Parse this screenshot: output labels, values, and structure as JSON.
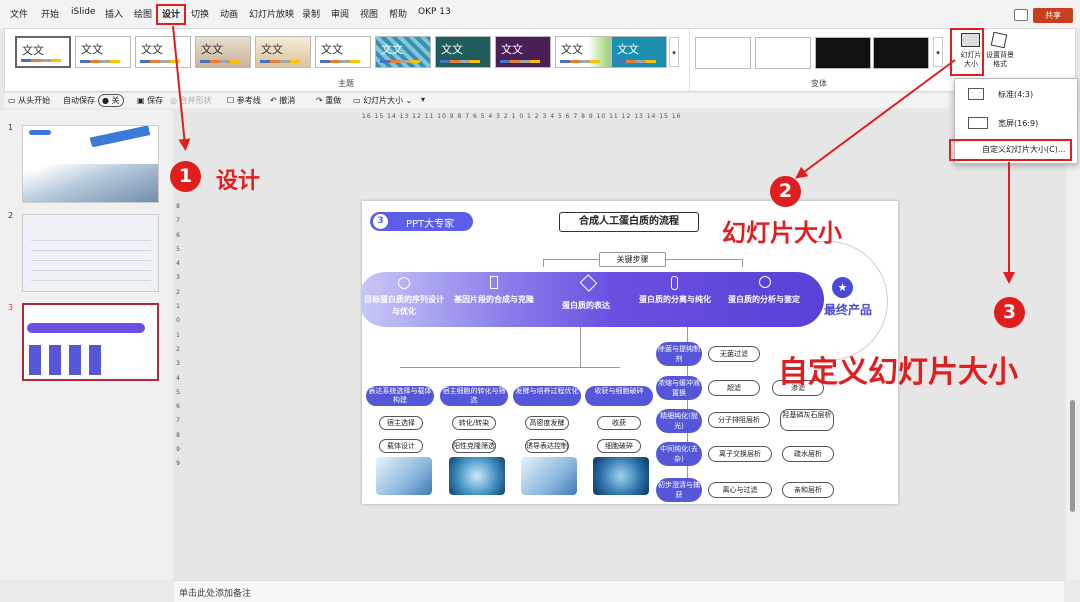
{
  "menu": [
    "文件",
    "开始",
    "iSlide",
    "插入",
    "绘图",
    "设计",
    "切换",
    "动画",
    "幻灯片放映",
    "录制",
    "审阅",
    "视图",
    "帮助",
    "OKP 13"
  ],
  "share_label": "共享",
  "ribbon": {
    "theme_text": "文文",
    "themes_label": "主题",
    "variants_label": "变体",
    "slide_size_label": "幻灯片大小",
    "bg_format_label": "设置背景格式"
  },
  "qat": [
    "从头开始",
    "自动保存",
    "关",
    "保存",
    "合并形状",
    "参考线",
    "撤消",
    "重做",
    "幻灯片大小"
  ],
  "rulers": {
    "horizontal": "16 15 14 13 12 11 10 9 8 7 6 5 4 3 2 1 0 1 2 3 4 5 6 7 8 9 10 11 12 13 14 15 16",
    "vertical": [
      "8",
      "7",
      "6",
      "5",
      "4",
      "3",
      "2",
      "1",
      "0",
      "1",
      "2",
      "3",
      "4",
      "5",
      "6",
      "7",
      "8",
      "9",
      "9"
    ]
  },
  "slides": [
    {
      "num": "1",
      "selected": false
    },
    {
      "num": "2",
      "selected": false
    },
    {
      "num": "3",
      "selected": true
    }
  ],
  "dropdown": {
    "standard": "标准(4:3)",
    "widescreen": "宽屏(16:9)",
    "custom": "自定义幻灯片大小(C)..."
  },
  "notes_placeholder": "单击此处添加备注",
  "annotations": {
    "step1_num": "1",
    "step1_text": "设计",
    "step2_num": "2",
    "step2_text": "幻灯片大小",
    "step3_num": "3",
    "step3_text": "自定义幻灯片大小"
  },
  "slide": {
    "badge_num": "3",
    "badge_text": "PPT大专家",
    "title": "合成人工蛋白质的流程",
    "key_steps": "关键步骤",
    "stages": [
      "目标蛋白质的序列设计与优化",
      "基因片段的合成与克隆",
      "蛋白质的表达",
      "蛋白质的分离与纯化",
      "蛋白质的分析与鉴定"
    ],
    "final_product": "最终产品",
    "columns": [
      {
        "header": "表达系统选择与载体构建",
        "items": [
          "宿主选择",
          "载体设计"
        ]
      },
      {
        "header": "宿主细胞的转化与筛选",
        "items": [
          "转化/转染",
          "阳性克隆筛选"
        ]
      },
      {
        "header": "发酵与培养过程优化",
        "items": [
          "高密度发酵",
          "诱导表达控制"
        ]
      },
      {
        "header": "收获与细胞破碎",
        "items": [
          "收获",
          "细胞破碎"
        ]
      }
    ],
    "right_rows": [
      {
        "header": "除菌与提纯制剂",
        "items": [
          "无菌过滤"
        ]
      },
      {
        "header": "浓缩与缓冲液置换",
        "items": [
          "超滤",
          "渗滤"
        ]
      },
      {
        "header": "精细纯化(抛光)",
        "items": [
          "分子排阻层析",
          "羟基磷灰石层析"
        ]
      },
      {
        "header": "中间纯化(去杂)",
        "items": [
          "离子交换层析",
          "疏水层析"
        ]
      },
      {
        "header": "初步澄清与捕获",
        "items": [
          "离心与过滤",
          "亲和层析"
        ]
      }
    ]
  }
}
